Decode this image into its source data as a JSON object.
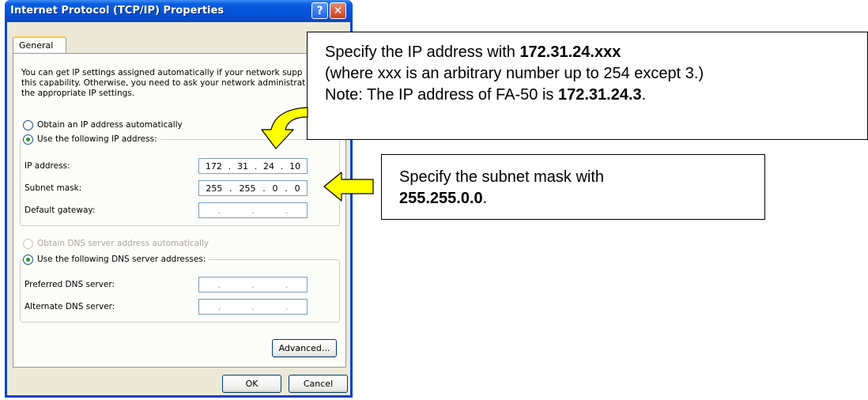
{
  "dialog": {
    "title": "Internet Protocol (TCP/IP) Properties",
    "help_label": "?",
    "close_label": "✕",
    "tab_general": "General",
    "description": "You can get IP settings assigned automatically if your network supp\nthis capability. Otherwise, you need to ask your network administrat\nthe appropriate IP settings.",
    "obtain_ip_auto": "Obtain an IP address automatically",
    "use_following_ip": "Use the following IP address:",
    "ip_address_label": "IP address:",
    "ip_address": [
      "172",
      "31",
      "24",
      "10"
    ],
    "subnet_mask_label": "Subnet mask:",
    "subnet_mask": [
      "255",
      "255",
      "0",
      "0"
    ],
    "default_gateway_label": "Default gateway:",
    "obtain_dns_auto": "Obtain DNS server address automatically",
    "use_following_dns": "Use the following DNS server addresses:",
    "preferred_dns_label": "Preferred DNS server:",
    "alternate_dns_label": "Alternate DNS server:",
    "advanced_button": "Advanced...",
    "ok_button": "OK",
    "cancel_button": "Cancel"
  },
  "callout_ip": {
    "line1_prefix": "Specify the IP address with ",
    "line1_bold": "172.31.24.xxx",
    "line2": "(where xxx is an arbitrary number up to 254 except 3.)",
    "line3_prefix": "Note: The IP address of FA-50 is ",
    "line3_bold": "172.31.24.3",
    "line3_suffix": "."
  },
  "callout_subnet": {
    "line1": "Specify the subnet mask with",
    "line2_bold": "255.255.0.0",
    "line2_suffix": "."
  },
  "colors": {
    "arrow_fill": "#ffff00",
    "titlebar": "#0551d6",
    "dialog_bg": "#ece9d8"
  }
}
